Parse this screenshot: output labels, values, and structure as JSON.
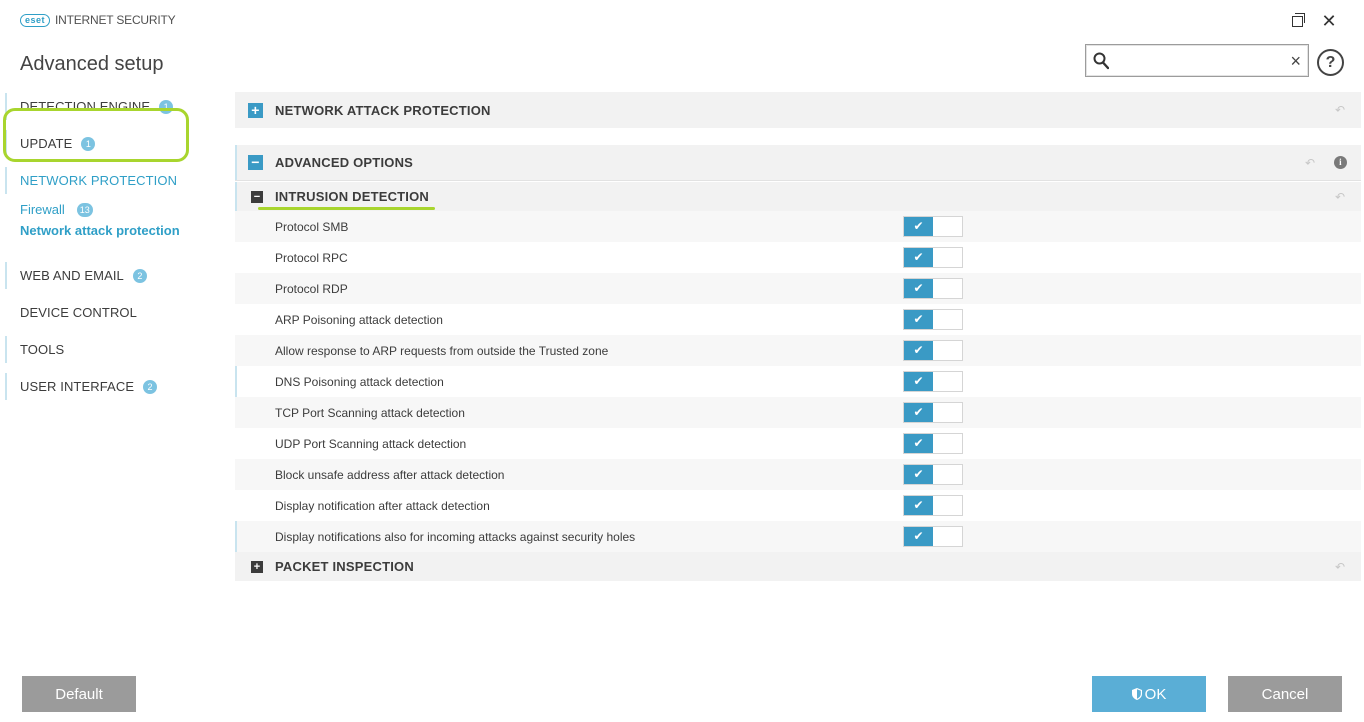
{
  "app": {
    "logo_badge": "eset",
    "product_name": "INTERNET SECURITY",
    "page_title": "Advanced setup"
  },
  "search": {
    "value": "",
    "placeholder": "",
    "clear_glyph": "×"
  },
  "help": {
    "glyph": "?"
  },
  "sidebar": {
    "items": [
      {
        "label": "DETECTION ENGINE",
        "badge": "1"
      },
      {
        "label": "UPDATE",
        "badge": "1"
      },
      {
        "label": "NETWORK PROTECTION",
        "badge": ""
      },
      {
        "label": "Firewall",
        "badge": "13"
      },
      {
        "label": "Network attack protection",
        "badge": ""
      },
      {
        "label": "WEB AND EMAIL",
        "badge": "2"
      },
      {
        "label": "DEVICE CONTROL",
        "badge": ""
      },
      {
        "label": "TOOLS",
        "badge": ""
      },
      {
        "label": "USER INTERFACE",
        "badge": "2"
      }
    ]
  },
  "sections": {
    "network_attack_protection": {
      "label": "NETWORK ATTACK PROTECTION",
      "expander": "+"
    },
    "advanced_options": {
      "label": "ADVANCED OPTIONS",
      "expander": "−",
      "info": "i"
    },
    "intrusion_detection": {
      "label": "INTRUSION DETECTION",
      "expander": "−"
    },
    "packet_inspection": {
      "label": "PACKET INSPECTION",
      "expander": "+"
    }
  },
  "settings": [
    {
      "label": "Protocol SMB",
      "enabled": true
    },
    {
      "label": "Protocol RPC",
      "enabled": true
    },
    {
      "label": "Protocol RDP",
      "enabled": true
    },
    {
      "label": "ARP Poisoning attack detection",
      "enabled": true
    },
    {
      "label": "Allow response to ARP requests from outside the Trusted zone",
      "enabled": true
    },
    {
      "label": "DNS Poisoning attack detection",
      "enabled": true
    },
    {
      "label": "TCP Port Scanning attack detection",
      "enabled": true
    },
    {
      "label": "UDP Port Scanning attack detection",
      "enabled": true
    },
    {
      "label": "Block unsafe address after attack detection",
      "enabled": true
    },
    {
      "label": "Display notification after attack detection",
      "enabled": true
    },
    {
      "label": "Display notifications also for incoming attacks against security holes",
      "enabled": true
    }
  ],
  "toggle_glyph": "✔",
  "revert_glyph": "↶",
  "footer": {
    "default_label": "Default",
    "ok_label": "OK",
    "cancel_label": "Cancel"
  },
  "colors": {
    "accent": "#2f9fc7",
    "toggle_on": "#3a9ac5",
    "highlight": "#a8d52e",
    "button_gray": "#9b9b9b",
    "button_ok": "#5aaed6"
  }
}
